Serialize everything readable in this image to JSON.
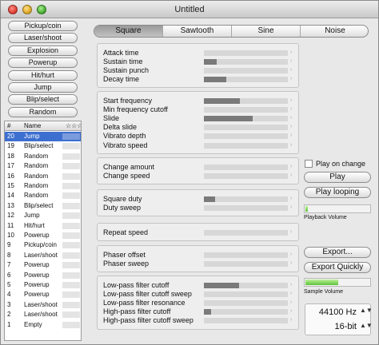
{
  "window": {
    "title": "Untitled"
  },
  "presets": [
    "Pickup/coin",
    "Laser/shoot",
    "Explosion",
    "Powerup",
    "Hit/hurt",
    "Jump",
    "Blip/select",
    "Random"
  ],
  "list": {
    "col_num": "#",
    "col_name": "Name",
    "col_stars": "☆☆☆",
    "rows": [
      {
        "num": "20",
        "name": "Jump"
      },
      {
        "num": "19",
        "name": "Blip/select"
      },
      {
        "num": "18",
        "name": "Random"
      },
      {
        "num": "17",
        "name": "Random"
      },
      {
        "num": "16",
        "name": "Random"
      },
      {
        "num": "15",
        "name": "Random"
      },
      {
        "num": "14",
        "name": "Random"
      },
      {
        "num": "13",
        "name": "Blip/select"
      },
      {
        "num": "12",
        "name": "Jump"
      },
      {
        "num": "11",
        "name": "Hit/hurt"
      },
      {
        "num": "10",
        "name": "Powerup"
      },
      {
        "num": "9",
        "name": "Pickup/coin"
      },
      {
        "num": "8",
        "name": "Laser/shoot"
      },
      {
        "num": "7",
        "name": "Powerup"
      },
      {
        "num": "6",
        "name": "Powerup"
      },
      {
        "num": "5",
        "name": "Powerup"
      },
      {
        "num": "4",
        "name": "Powerup"
      },
      {
        "num": "3",
        "name": "Laser/shoot"
      },
      {
        "num": "2",
        "name": "Laser/shoot"
      },
      {
        "num": "1",
        "name": "Empty"
      }
    ]
  },
  "tabs": [
    "Square",
    "Sawtooth",
    "Sine",
    "Noise"
  ],
  "active_tab": "Square",
  "groups": [
    {
      "params": [
        {
          "label": "Attack time",
          "value": 0
        },
        {
          "label": "Sustain time",
          "value": 0.15
        },
        {
          "label": "Sustain punch",
          "value": 0
        },
        {
          "label": "Decay time",
          "value": 0.27
        }
      ]
    },
    {
      "params": [
        {
          "label": "Start frequency",
          "value": 0.43
        },
        {
          "label": "Min frequency cutoff",
          "value": 0
        },
        {
          "label": "Slide",
          "value": 0.58
        },
        {
          "label": "Delta slide",
          "value": 0
        },
        {
          "label": "Vibrato depth",
          "value": 0
        },
        {
          "label": "Vibrato speed",
          "value": 0
        }
      ]
    },
    {
      "params": [
        {
          "label": "Change amount",
          "value": 0
        },
        {
          "label": "Change speed",
          "value": 0
        }
      ]
    },
    {
      "params": [
        {
          "label": "Square duty",
          "value": 0.13
        },
        {
          "label": "Duty sweep",
          "value": 0
        }
      ]
    },
    {
      "params": [
        {
          "label": "Repeat speed",
          "value": 0
        }
      ]
    },
    {
      "params": [
        {
          "label": "Phaser offset",
          "value": 0
        },
        {
          "label": "Phaser sweep",
          "value": 0
        }
      ]
    },
    {
      "params": [
        {
          "label": "Low-pass filter cutoff",
          "value": 0.42
        },
        {
          "label": "Low-pass filter cutoff sweep",
          "value": 0
        },
        {
          "label": "Low-pass filter resonance",
          "value": 0
        },
        {
          "label": "High-pass filter cutoff",
          "value": 0.09
        },
        {
          "label": "High-pass filter cutoff sweep",
          "value": 0
        }
      ]
    }
  ],
  "right": {
    "play_on_change": "Play on change",
    "play_on_change_checked": false,
    "play": "Play",
    "play_looping": "Play looping",
    "playback_volume_label": "Playback Volume",
    "playback_volume": 0.04,
    "export": "Export...",
    "export_quickly": "Export Quickly",
    "sample_volume_label": "Sample Volume",
    "sample_volume": 0.5,
    "sample_rate": "44100 Hz",
    "bit_depth": "16-bit"
  },
  "colors": {
    "selection": "#3d6fd0",
    "meter_fill": "#5cc23a",
    "slider_fill": "#7a7a7a"
  }
}
